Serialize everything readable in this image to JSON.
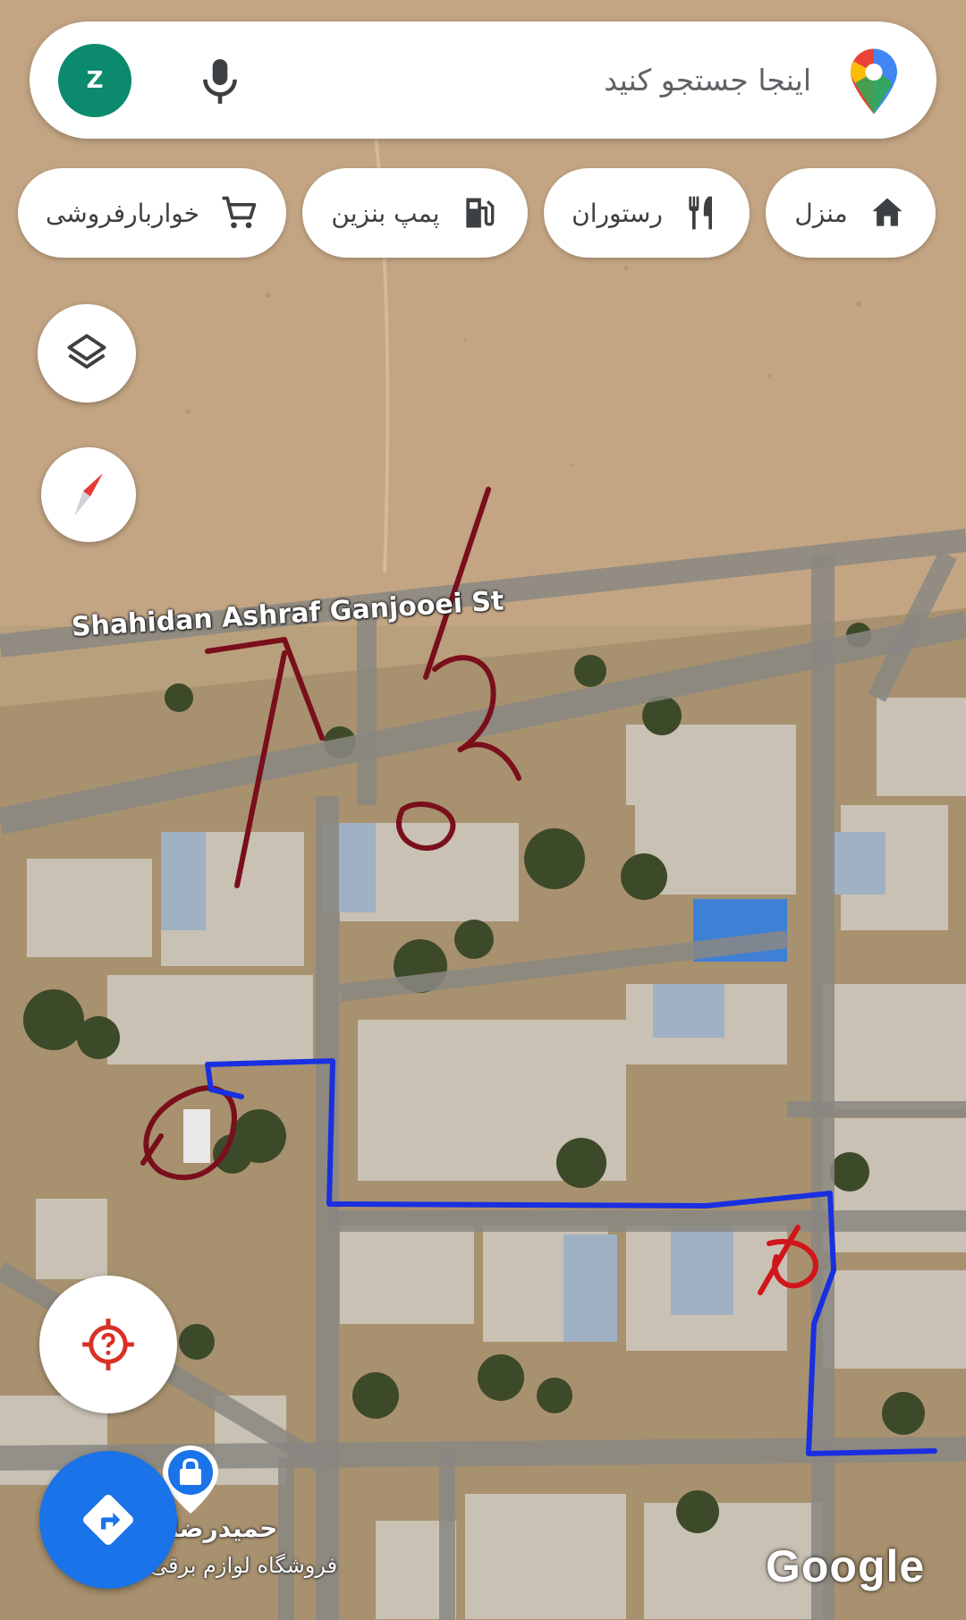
{
  "search": {
    "avatar_letter": "Z",
    "placeholder": "اینجا جستجو کنید"
  },
  "chips": [
    {
      "label": "منزل",
      "icon": "home-icon"
    },
    {
      "label": "رستوران",
      "icon": "restaurant-icon"
    },
    {
      "label": "پمپ بنزین",
      "icon": "gas-station-icon"
    },
    {
      "label": "خواربارفروشی",
      "icon": "shopping-cart-icon"
    }
  ],
  "map": {
    "street_name": "Shahidan Ashraf Ganjooei St",
    "poi": {
      "name": "حمیدرضا",
      "category": "فروشگاه لوازم برقی",
      "icon": "shopping-bag-icon"
    },
    "attribution": "Google"
  },
  "annotations": {
    "handwritten_text": "12",
    "colors": {
      "red": "#7a0f1c",
      "blue": "#1a2fe0",
      "x_mark": "#d0161b"
    }
  },
  "buttons": {
    "layers": "layers-icon",
    "compass": "compass-icon",
    "location": "location-unknown-icon",
    "directions": "directions-icon"
  },
  "colors": {
    "avatar": "#0b8a6e",
    "directions_fab": "#1a73e8",
    "location_icon": "#d93025"
  }
}
